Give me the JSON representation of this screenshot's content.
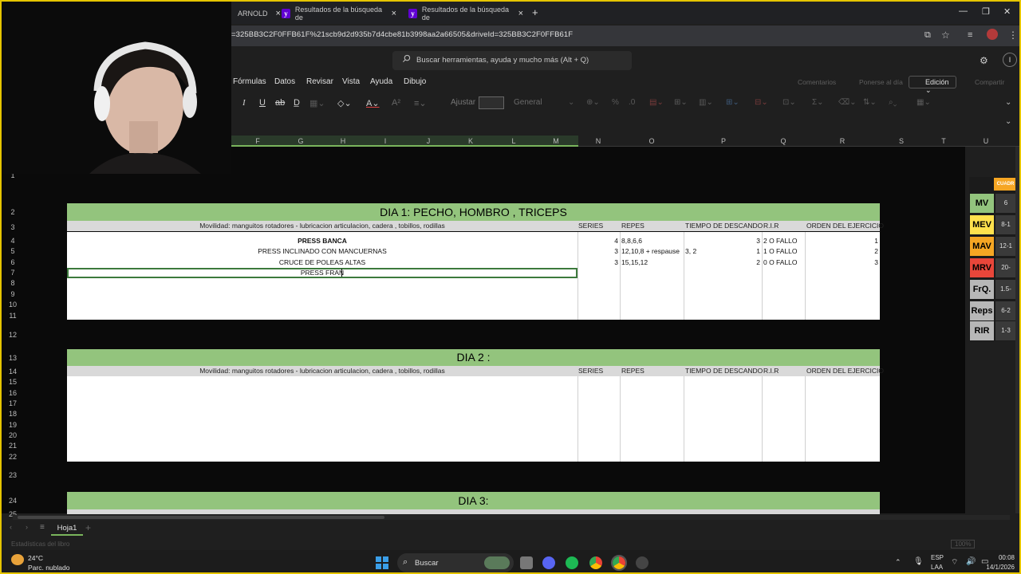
{
  "browser": {
    "tabs": [
      {
        "label": "ARNOLD",
        "close": "×"
      },
      {
        "label": "Resultados de la búsqueda de",
        "close": "×"
      },
      {
        "label": "Resultados de la búsqueda de",
        "close": "×"
      }
    ],
    "new_tab": "+",
    "url": "=325BB3C2F0FFB61F%21scb9d2d935b7d4cbe81b3998aa2a66505&driveId=325BB3C2F0FFB61F"
  },
  "app": {
    "search_placeholder": "Buscar herramientas, ayuda y mucho más (Alt + Q)",
    "menus": [
      "Fórmulas",
      "Datos",
      "Revisar",
      "Vista",
      "Ayuda",
      "Dibujo"
    ],
    "comments": "Comentarios",
    "catch_up": "Ponerse al día",
    "edit_mode": "Edición",
    "share": "Compartir",
    "ribbon": {
      "wrap": "Ajustar",
      "number_format": "General"
    }
  },
  "columns": [
    "F",
    "G",
    "H",
    "I",
    "J",
    "K",
    "L",
    "M",
    "N",
    "O",
    "P",
    "Q",
    "R",
    "S",
    "T",
    "U"
  ],
  "rows": [
    "1",
    "2",
    "3",
    "4",
    "5",
    "6",
    "7",
    "8",
    "9",
    "10",
    "11",
    "12",
    "13",
    "14",
    "15",
    "16",
    "17",
    "18",
    "19",
    "20",
    "21",
    "22",
    "23",
    "24",
    "25"
  ],
  "headers": {
    "mobility": "Movilidad: manguitos rotadores - lubricacion articulacion, cadera , tobillos, rodillas",
    "series": "SERIES",
    "repes": "REPES",
    "descanso": "TIEMPO DE DESCANDO",
    "rir": "R.I.R",
    "orden": "ORDEN DEL EJERCICIO"
  },
  "days": [
    {
      "title": "DIA 1: PECHO, HOMBRO , TRICEPS",
      "exercises": [
        {
          "name": "PRESS BANCA",
          "series": "4",
          "repes": "8,8,6,6",
          "rest_note": "",
          "rest": "3",
          "rir": "2 O FALLO",
          "order": "1"
        },
        {
          "name": "PRESS INCLINADO CON MANCUERNAS",
          "series": "3",
          "repes": "12,10,8 + respause",
          "rest_note": "3, 2",
          "rest": "1",
          "rir": "1 O FALLO",
          "order": "2"
        },
        {
          "name": "CRUCE DE POLEAS ALTAS",
          "series": "3",
          "repes": "15,15,12",
          "rest_note": "",
          "rest": "2",
          "rir": "0 O FALLO",
          "order": "3"
        }
      ],
      "editing": "PRESS FRAN"
    },
    {
      "title": "DIA 2 :"
    },
    {
      "title": "DIA 3:"
    }
  ],
  "side_panel": {
    "header": "CUADR",
    "items": [
      {
        "label": "MV",
        "value": "6",
        "color": "#93c47d"
      },
      {
        "label": "MEV",
        "value": "8-1",
        "color": "#ffe14d"
      },
      {
        "label": "MAV",
        "value": "12-1",
        "color": "#f6a623"
      },
      {
        "label": "MRV",
        "value": "20-",
        "color": "#e8463a"
      },
      {
        "label": "FrQ.",
        "value": "1.5-",
        "color": "#b7b7b7"
      },
      {
        "label": "Reps",
        "value": "6-2",
        "color": "#b7b7b7"
      },
      {
        "label": "RIR",
        "value": "1-3",
        "color": "#b7b7b7"
      }
    ]
  },
  "sheet": {
    "tab": "Hoja1",
    "status": "Estadísticas del libro",
    "zoom": "100%"
  },
  "taskbar": {
    "weather_temp": "24°C",
    "weather_desc": "Parc. nublado",
    "search": "Buscar",
    "lang_top": "ESP",
    "lang_bottom": "LAA",
    "time": "00:08",
    "date": "14/1/2026"
  },
  "colors": {
    "accent_green": "#93c47d",
    "header_gray": "#d9d9d9",
    "frame_yellow": "#e5c400"
  }
}
